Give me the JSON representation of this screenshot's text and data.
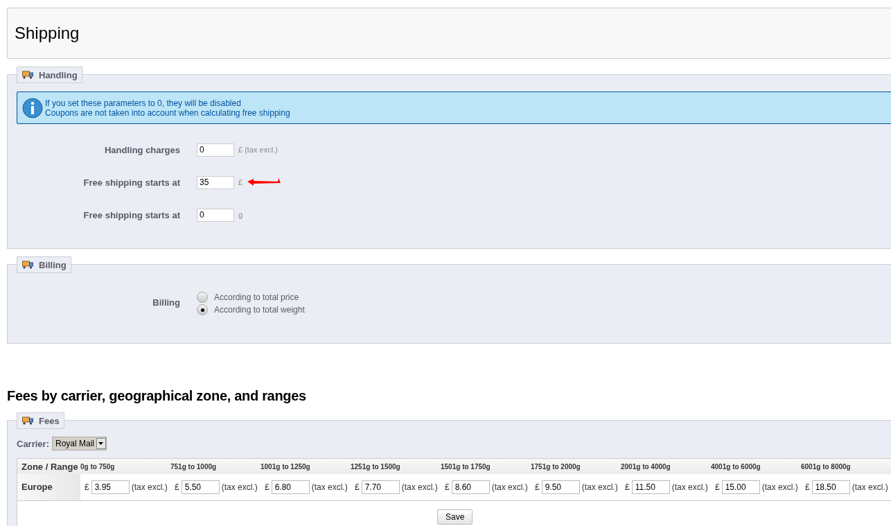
{
  "page_title": "Shipping",
  "handling": {
    "legend": "Handling",
    "info": [
      "If you set these parameters to 0, they will be disabled",
      "Coupons are not taken into account when calculating free shipping"
    ],
    "fields": [
      {
        "label": "Handling charges",
        "value": "0",
        "unit": "£ (tax excl.)",
        "annotated": false
      },
      {
        "label": "Free shipping starts at",
        "value": "35",
        "unit": "£",
        "annotated": true
      },
      {
        "label": "Free shipping starts at",
        "value": "0",
        "unit": "g",
        "annotated": false
      }
    ]
  },
  "billing": {
    "legend": "Billing",
    "label": "Billing",
    "options": [
      {
        "label": "According to total price",
        "selected": false
      },
      {
        "label": "According to total weight",
        "selected": true
      }
    ]
  },
  "fees_heading": "Fees by carrier, geographical zone, and ranges",
  "fees": {
    "legend": "Fees",
    "carrier_label": "Carrier:",
    "carrier": "Royal Mail",
    "corner": "Zone / Range",
    "ranges": [
      "0g to 750g",
      "751g to 1000g",
      "1001g to 1250g",
      "1251g to 1500g",
      "1501g to 1750g",
      "1751g to 2000g",
      "2001g to 4000g",
      "4001g to 6000g",
      "6001g to 8000g"
    ],
    "rows": [
      {
        "zone": "Europe",
        "cells": [
          {
            "currency": "£",
            "value": "3.95",
            "suffix": "(tax excl.)"
          },
          {
            "currency": "£",
            "value": "5.50",
            "suffix": "(tax excl.)"
          },
          {
            "currency": "£",
            "value": "6.80",
            "suffix": "(tax excl.)"
          },
          {
            "currency": "£",
            "value": "7.70",
            "suffix": "(tax excl.)"
          },
          {
            "currency": "£",
            "value": "8.60",
            "suffix": "(tax excl.)"
          },
          {
            "currency": "£",
            "value": "9.50",
            "suffix": "(tax excl.)"
          },
          {
            "currency": "£",
            "value": "11.50",
            "suffix": "(tax excl.)"
          },
          {
            "currency": "£",
            "value": "15.00",
            "suffix": "(tax excl.)"
          },
          {
            "currency": "£",
            "value": "18.50",
            "suffix": "(tax excl.)"
          }
        ]
      }
    ],
    "save": "Save"
  }
}
